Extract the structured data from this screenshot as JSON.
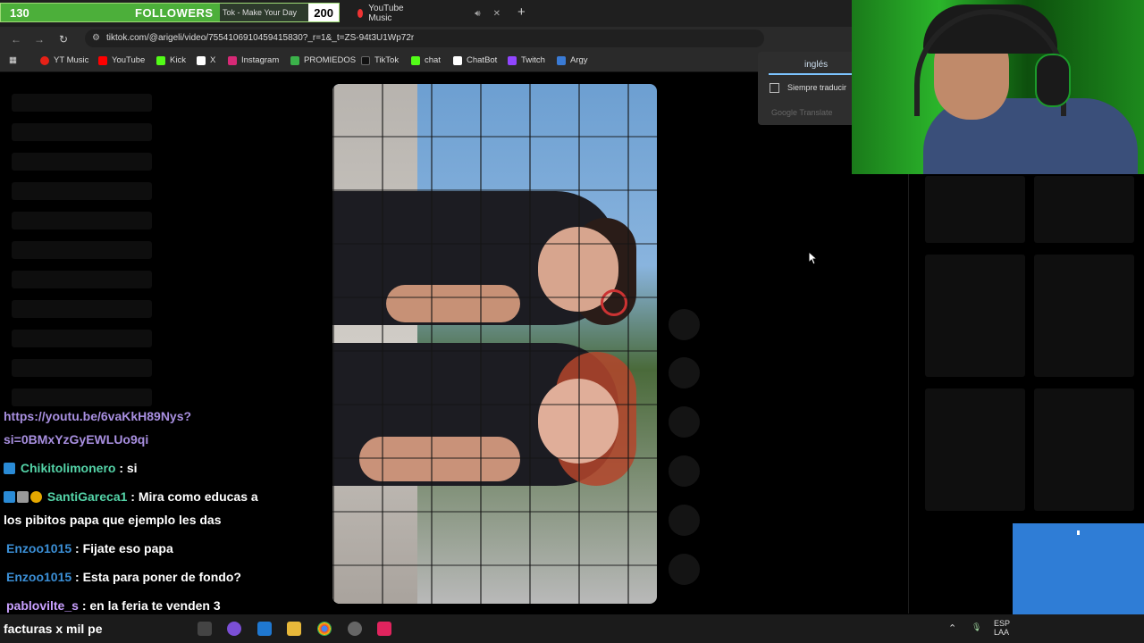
{
  "followers_widget": {
    "count": "130",
    "label": "FOLLOWERS",
    "goal": "200",
    "progress": 0.65
  },
  "tabs": [
    {
      "label": "Tok - Make Your Day"
    },
    {
      "label": "YouTube Music"
    }
  ],
  "address": {
    "url": "tiktok.com/@arigeli/video/7554106910459415830?_r=1&_t=ZS-94t3U1Wp72r"
  },
  "bookmarks": [
    {
      "label": "YT Music",
      "icon": "ytmusic-icon",
      "color": "#e62117"
    },
    {
      "label": "YouTube",
      "icon": "youtube-icon",
      "color": "#ff0000"
    },
    {
      "label": "Kick",
      "icon": "kick-icon",
      "color": "#53fc18"
    },
    {
      "label": "X",
      "icon": "x-icon",
      "color": "#ffffff"
    },
    {
      "label": "Instagram",
      "icon": "instagram-icon",
      "color": "#d62976"
    },
    {
      "label": "PROMIEDOS",
      "icon": "promiedos-icon",
      "color": "#3bb24a"
    },
    {
      "label": "TikTok",
      "icon": "tiktok-icon",
      "color": "#111111"
    },
    {
      "label": "chat",
      "icon": "chat-icon",
      "color": "#53fc18"
    },
    {
      "label": "ChatBot",
      "icon": "chatbot-icon",
      "color": "#ffffff"
    },
    {
      "label": "Twitch",
      "icon": "twitch-icon",
      "color": "#9146ff"
    },
    {
      "label": "Argy",
      "icon": "argy-icon",
      "color": "#3a7bd5"
    }
  ],
  "translate": {
    "lang": "inglés",
    "always": "Siempre traducir",
    "brand": "Google Translate"
  },
  "chat": {
    "link_line1": "https://youtu.be/6vaKkH89Nys?",
    "link_line2": "si=0BMxYzGyEWLUo9qi",
    "messages": [
      {
        "user": "Chikitolimonero",
        "text": ": si",
        "color": "#54d4a8"
      },
      {
        "user": "SantiGareca1",
        "text": ": Mira como educas a",
        "cont": "los pibitos papa que ejemplo les das",
        "color": "#54d4a8"
      },
      {
        "user": "Enzoo1015",
        "text": ": Fijate eso papa",
        "color": "#3b8fd6"
      },
      {
        "user": "Enzoo1015",
        "text": ": Esta para poner de fondo?",
        "color": "#3b8fd6"
      },
      {
        "user": "pablovilte_s",
        "text": ": en la feria te venden 3",
        "cont": "facturas x mil pe",
        "color": "#c9a0ff"
      }
    ]
  },
  "taskbar": {
    "lang1": "ESP",
    "lang2": "LAA"
  }
}
